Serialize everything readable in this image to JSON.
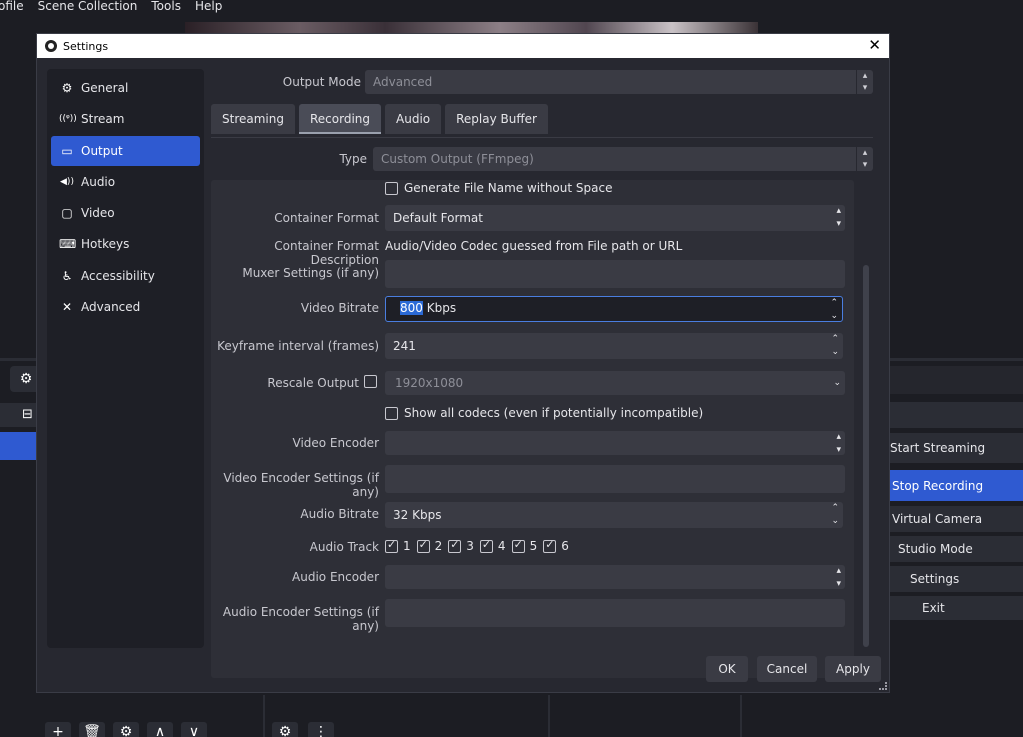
{
  "menubar": {
    "items": [
      "ofile",
      "Scene Collection",
      "Tools",
      "Help"
    ]
  },
  "controls": {
    "buttons": [
      "Start Streaming",
      "Stop Recording",
      "Virtual Camera",
      "Studio Mode",
      "Settings",
      "Exit"
    ],
    "active": "Stop Recording"
  },
  "dialog": {
    "title": "Settings",
    "close": "✕",
    "sidebar": [
      {
        "label": "General",
        "icon": "gear-icon",
        "glyph": "⚙"
      },
      {
        "label": "Stream",
        "icon": "antenna-icon",
        "glyph": "((ᵠ))"
      },
      {
        "label": "Output",
        "icon": "monitor-output-icon",
        "glyph": "▭",
        "selected": true
      },
      {
        "label": "Audio",
        "icon": "speaker-icon",
        "glyph": "◀))"
      },
      {
        "label": "Video",
        "icon": "display-icon",
        "glyph": "▢"
      },
      {
        "label": "Hotkeys",
        "icon": "keyboard-icon",
        "glyph": "⌨"
      },
      {
        "label": "Accessibility",
        "icon": "accessibility-icon",
        "glyph": "♿"
      },
      {
        "label": "Advanced",
        "icon": "tools-icon",
        "glyph": "✕"
      }
    ],
    "output_mode": {
      "label": "Output Mode",
      "value": "Advanced"
    },
    "tabs": [
      "Streaming",
      "Recording",
      "Audio",
      "Replay Buffer"
    ],
    "selected_tab": "Recording",
    "type": {
      "label": "Type",
      "value": "Custom Output (FFmpeg)"
    },
    "generate_filename": {
      "label": "Generate File Name without Space",
      "checked": false
    },
    "container_format": {
      "label": "Container Format",
      "value": "Default Format"
    },
    "container_desc": {
      "label": "Container Format Description",
      "value": "Audio/Video Codec guessed from File path or URL"
    },
    "muxer_settings": {
      "label": "Muxer Settings (if any)",
      "value": ""
    },
    "video_bitrate": {
      "label": "Video Bitrate",
      "value_selected": "800",
      "value_caret": "",
      "suffix": " Kbps"
    },
    "keyframe_interval": {
      "label": "Keyframe interval (frames)",
      "value": "241"
    },
    "rescale_output": {
      "label": "Rescale Output",
      "checked": false,
      "value": "1920x1080"
    },
    "show_all_codecs": {
      "label": "Show all codecs (even if potentially incompatible)",
      "checked": false
    },
    "video_encoder": {
      "label": "Video Encoder",
      "value": ""
    },
    "video_encoder_settings": {
      "label": "Video Encoder Settings (if any)",
      "value": ""
    },
    "audio_bitrate": {
      "label": "Audio Bitrate",
      "value": "32 Kbps"
    },
    "audio_track": {
      "label": "Audio Track",
      "tracks": [
        "1",
        "2",
        "3",
        "4",
        "5",
        "6"
      ]
    },
    "audio_encoder": {
      "label": "Audio Encoder",
      "value": ""
    },
    "audio_encoder_settings": {
      "label": "Audio Encoder Settings (if any)",
      "value": ""
    },
    "buttons": {
      "ok": "OK",
      "cancel": "Cancel",
      "apply": "Apply"
    }
  }
}
